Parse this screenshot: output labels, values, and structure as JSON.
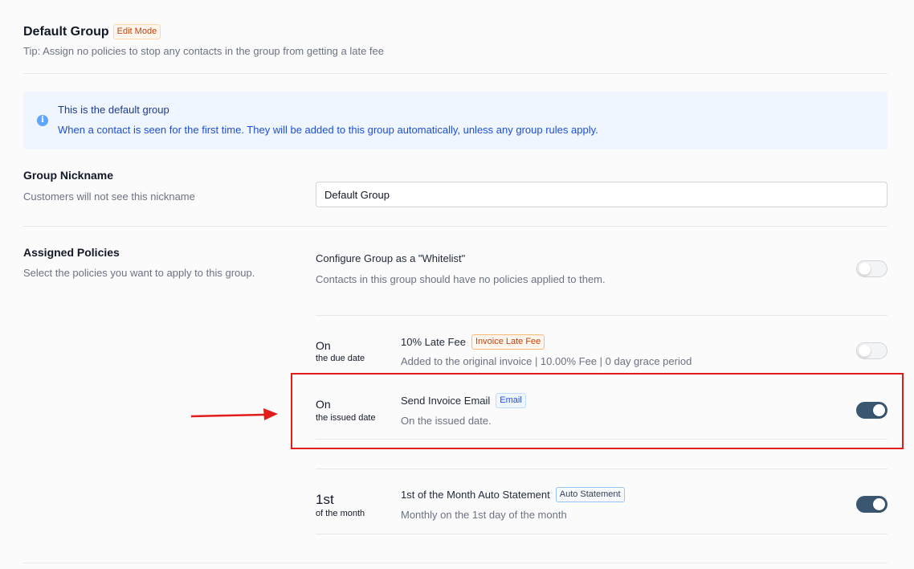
{
  "header": {
    "title": "Default Group",
    "mode_badge": "Edit Mode",
    "tip": "Tip: Assign no policies to stop any contacts in the group from getting a late fee"
  },
  "info": {
    "icon": "info-icon",
    "title": "This is the default group",
    "text": "When a contact is seen for the first time. They will be added to this group automatically, unless any group rules apply."
  },
  "nickname": {
    "title": "Group Nickname",
    "description": "Customers will not see this nickname",
    "value": "Default Group"
  },
  "policies": {
    "title": "Assigned Policies",
    "description": "Select the policies you want to apply to this group.",
    "whitelist": {
      "title": "Configure Group as a \"Whitelist\"",
      "description": "Contacts in this group should have no policies applied to them.",
      "enabled": false
    },
    "items": [
      {
        "timing": "On",
        "timing_sub": "the due date",
        "name": "10% Late Fee",
        "badge": "Invoice Late Fee",
        "description": "Added to the original invoice | 10.00% Fee | 0 day grace period",
        "enabled": false
      },
      {
        "timing": "On",
        "timing_sub": "the issued date",
        "name": "Send Invoice Email",
        "badge": "Email",
        "description": "On the issued date.",
        "enabled": true
      },
      {
        "timing": "1st",
        "timing_sub": "of the month",
        "name": "1st of the Month Auto Statement",
        "badge": "Auto Statement",
        "description": "Monthly on the 1st day of the month",
        "enabled": true
      }
    ]
  },
  "colors": {
    "toggle_on": "#3b5670",
    "annotation": "#e31b1b",
    "info_bg": "#eff6ff"
  }
}
